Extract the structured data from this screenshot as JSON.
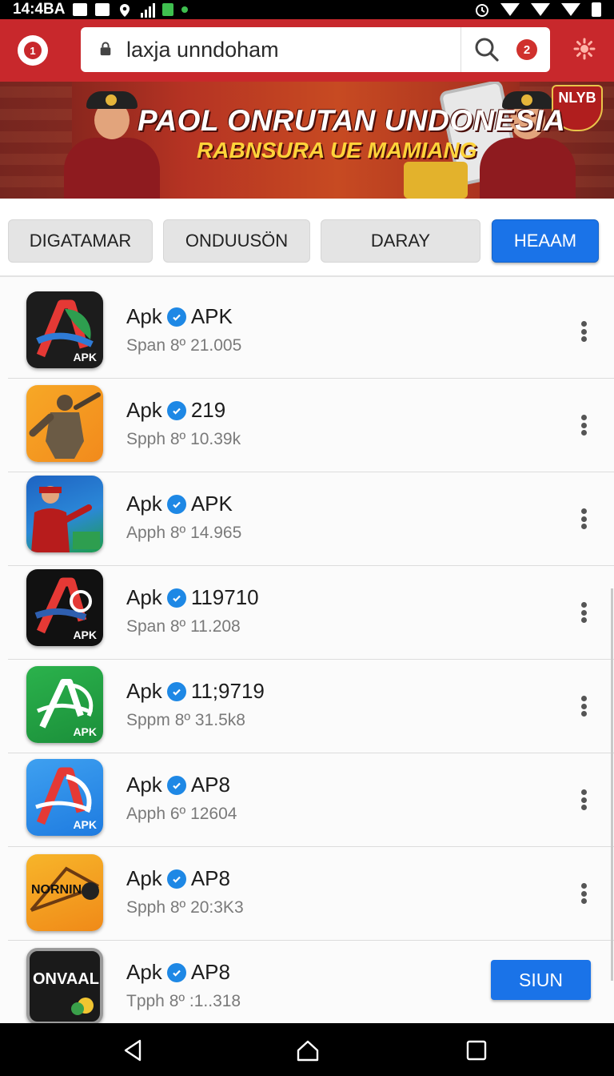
{
  "status_bar": {
    "time": "14:4BA"
  },
  "top_bar": {
    "logo_badge": "1",
    "search_value": "laxja unndoham",
    "notification_count": "2"
  },
  "banner": {
    "title": "PAOL ONRUTAN UNDONESIA",
    "subtitle": "RABNSURA UE MAMIANG",
    "shield_text": "NLYB"
  },
  "tabs": [
    {
      "label": "DIGATAMAR",
      "active": false
    },
    {
      "label": "ONDUUSÖN",
      "active": false
    },
    {
      "label": "DARAY",
      "active": false
    },
    {
      "label": "HEAAM",
      "active": true
    }
  ],
  "apps": [
    {
      "prefix": "Apk",
      "name": "APK",
      "meta": "Span 8º  21.005",
      "icon": "apk-letter-a-dark-icon"
    },
    {
      "prefix": "Apk",
      "name": "219",
      "meta": "Spph 8º  10.39k",
      "icon": "statue-game-icon"
    },
    {
      "prefix": "Apk",
      "name": "APK",
      "meta": "Apph 8º  14.965",
      "icon": "officer-poster-icon"
    },
    {
      "prefix": "Apk",
      "name": "119710",
      "meta": "Span 8º  11.208",
      "icon": "apk-letter-a-black-icon"
    },
    {
      "prefix": "Apk",
      "name": "11;9719",
      "meta": "Sppm 8º  31.5k8",
      "icon": "apk-green-icon"
    },
    {
      "prefix": "Apk",
      "name": "AP8",
      "meta": "Apph 6º  12604",
      "icon": "apk-blue-icon"
    },
    {
      "prefix": "Apk",
      "name": "AP8",
      "meta": "Spph 8º  20:3K3",
      "icon": "nornin-game-icon"
    },
    {
      "prefix": "Apk",
      "name": "AP8",
      "meta": "Tpph 8º  :1..318",
      "icon": "onvaal-game-icon"
    }
  ],
  "icon_labels": {
    "apk": "APK",
    "nornin": "NORNIN",
    "onvaal": "ONVAAL"
  },
  "sign_button": "SIUN",
  "colors": {
    "topbar": "#c8282c",
    "accent_blue": "#1a73e8",
    "verified_blue": "#1e88e5"
  }
}
